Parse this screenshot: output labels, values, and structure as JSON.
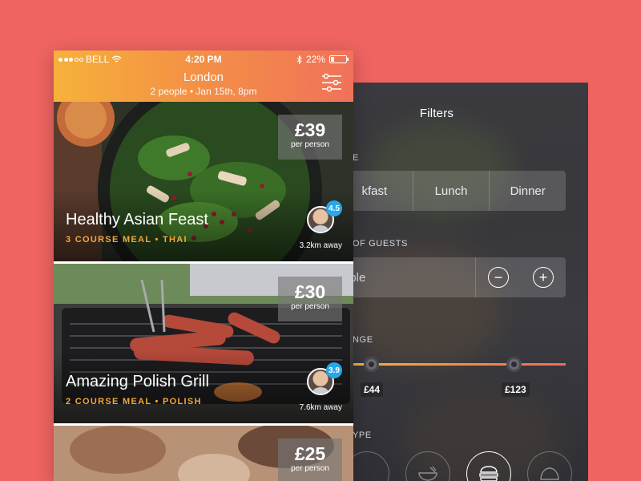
{
  "status_bar": {
    "carrier": "BELL",
    "time": "4:20 PM",
    "battery": "22%"
  },
  "header": {
    "city": "London",
    "subtitle": "2 people • Jan 15th, 8pm",
    "filter_icon": "sliders-icon"
  },
  "meals": [
    {
      "title": "Healthy Asian Feast",
      "meta": "3 COURSE MEAL • THAI",
      "price": "£39",
      "price_unit": "per person",
      "rating": "4.5",
      "distance": "3.2km away"
    },
    {
      "title": "Amazing Polish Grill",
      "meta": "2 COURSE MEAL • POLISH",
      "price": "£30",
      "price_unit": "per person",
      "rating": "3.9",
      "distance": "7.6km away"
    },
    {
      "price": "£25",
      "price_unit": "per person"
    }
  ],
  "filters": {
    "title": "Filters",
    "time_label": "E",
    "times": [
      "kfast",
      "Lunch",
      "Dinner"
    ],
    "guests_label": "OF GUESTS",
    "guests_value": "ople",
    "minus": "−",
    "plus": "+",
    "price_label": "NGE",
    "price_min": "£44",
    "price_max": "£123",
    "type_label": "YPE"
  },
  "colors": {
    "background": "#ef6461",
    "header_gradient_start": "#f6b13b",
    "header_gradient_end": "#f0725a",
    "accent_meta": "#f5a73b",
    "rating_badge": "#28a7e9"
  }
}
